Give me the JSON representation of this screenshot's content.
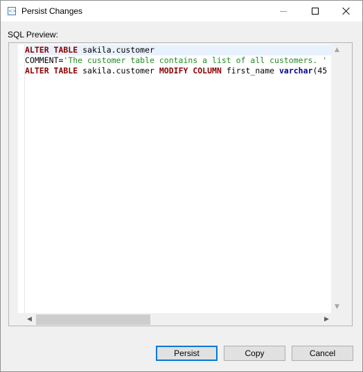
{
  "window": {
    "title": "Persist Changes",
    "icon": "sql-document-icon"
  },
  "titlebar_buttons": {
    "minimize": "minimize-icon",
    "maximize": "maximize-icon",
    "close": "close-icon"
  },
  "sql_preview": {
    "label": "SQL Preview:",
    "lines": [
      [
        {
          "text": "ALTER TABLE",
          "style": "kw"
        },
        {
          "text": " sakila.customer",
          "style": "plain"
        }
      ],
      [
        {
          "text": "COMMENT=",
          "style": "plain"
        },
        {
          "text": "'The customer table contains a list of all customers. '",
          "style": "str"
        }
      ],
      [
        {
          "text": "ALTER TABLE",
          "style": "kw"
        },
        {
          "text": " sakila.customer ",
          "style": "plain"
        },
        {
          "text": "MODIFY COLUMN",
          "style": "kw"
        },
        {
          "text": " first_name ",
          "style": "plain"
        },
        {
          "text": "varchar",
          "style": "type"
        },
        {
          "text": "(45",
          "style": "plain"
        }
      ]
    ]
  },
  "scrollbars": {
    "vertical_up": "▲",
    "vertical_down": "▼",
    "horizontal_left": "◀",
    "horizontal_right": "▶"
  },
  "buttons": {
    "persist": "Persist",
    "copy": "Copy",
    "cancel": "Cancel"
  },
  "colors": {
    "keyword": "#8b0000",
    "string": "#228b22",
    "type": "#00008b",
    "current_line": "#e8f2fe",
    "default_button_border": "#0078d7"
  }
}
